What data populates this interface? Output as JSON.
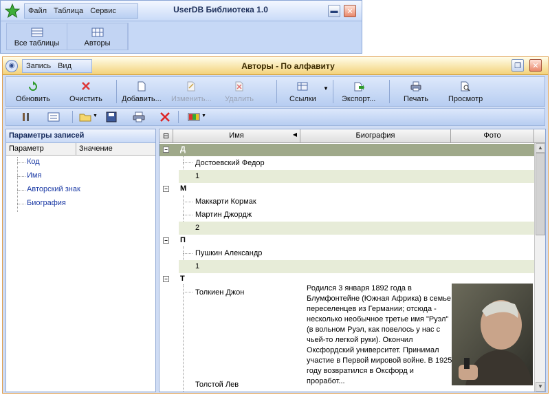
{
  "main_window": {
    "title": "UserDB Библиотека 1.0",
    "menu": [
      "Файл",
      "Таблица",
      "Сервис"
    ],
    "buttons": [
      "Все таблицы",
      "Авторы"
    ]
  },
  "child_window": {
    "title": "Авторы - По алфавиту",
    "menu": [
      "Запись",
      "Вид"
    ],
    "toolbar": {
      "refresh": "Обновить",
      "clear": "Очистить",
      "add": "Добавить...",
      "edit": "Изменить...",
      "delete": "Удалить",
      "links": "Ссылки",
      "export": "Экспорт...",
      "print": "Печать",
      "preview": "Просмотр"
    },
    "params": {
      "title": "Параметры записей",
      "col_param": "Параметр",
      "col_value": "Значение",
      "items": [
        "Код",
        "Имя",
        "Авторский знак",
        "Биография"
      ]
    },
    "grid": {
      "columns": [
        "Имя",
        "Биография",
        "Фото"
      ],
      "groups": [
        {
          "letter": "Д",
          "names": [
            "Достоевский Федор"
          ],
          "count": "1"
        },
        {
          "letter": "М",
          "names": [
            "Маккарти Кормак",
            "Мартин Джордж"
          ],
          "count": "2"
        },
        {
          "letter": "П",
          "names": [
            "Пушкин Александр"
          ],
          "count": "1"
        },
        {
          "letter": "Т",
          "names": [
            "Толкиен Джон",
            "Толстой Лев"
          ]
        }
      ],
      "bio_tolkien": "Родился 3 января 1892 года в Блумфонтейне (Южная Африка) в семье переселенцев из Германии; отсюда - несколько необычное третье имя \"Руэл\" (в вольном Руэл, как повелось у нас с чьей-то легкой руки). Окончил Оксфордский университет. Принимал участие в Первой мировой войне. В 1925 году возвратился в Оксфорд и проработ...",
      "photo_icon": "portrait-photo"
    }
  }
}
